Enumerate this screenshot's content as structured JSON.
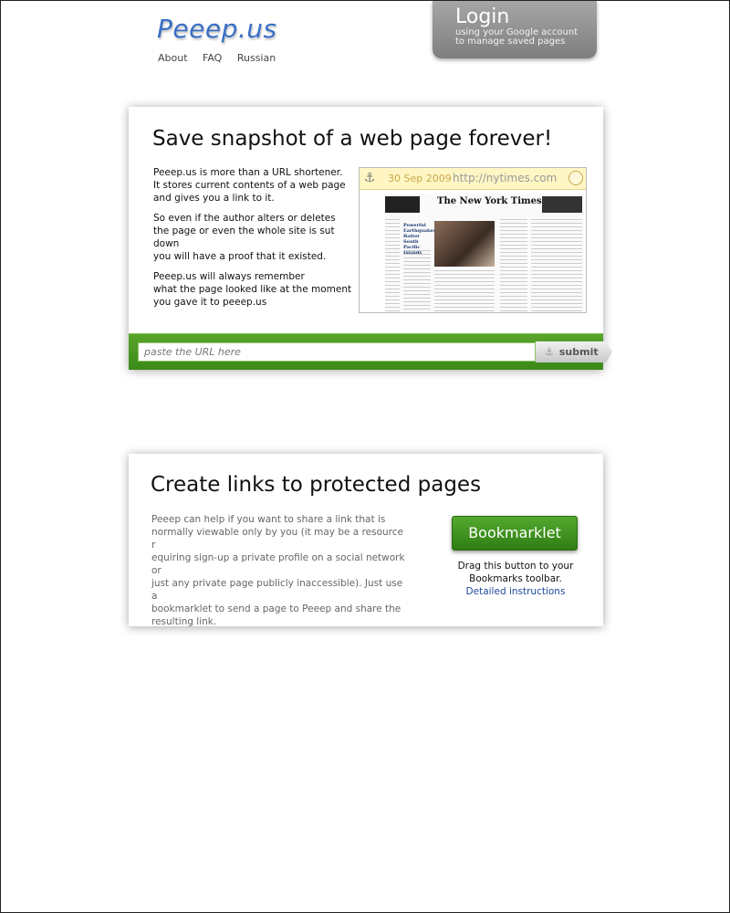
{
  "header": {
    "logo": "Peeep.us",
    "nav": [
      "About",
      "FAQ",
      "Russian"
    ]
  },
  "login": {
    "title": "Login",
    "subtitle_line1": "using your Google account",
    "subtitle_line2": "to manage saved pages"
  },
  "snapshot": {
    "title": "Save snapshot of a web page forever!",
    "paragraphs": [
      [
        "Peeep.us is more than a URL shortener.",
        "It stores current contents of a web page",
        "and gives you a link to it."
      ],
      [
        "So even if the author alters or deletes",
        "the page or even the whole site is sut down",
        "you will have a proof that it existed."
      ],
      [
        "Peeep.us will always remember",
        "what the page looked like at the moment",
        "you gave it to peeep.us"
      ]
    ],
    "preview": {
      "date": "30 Sep 2009",
      "url": "http://nytimes.com",
      "masthead": "The New York Times",
      "headline": "Powerful Earthquakes Batter South Pacific Islands"
    },
    "url_placeholder": "paste the URL here",
    "submit_label": "submit"
  },
  "protected": {
    "title": "Create links to protected pages",
    "lines": [
      "Peeep can help if you want to share a link that is",
      "normally viewable only by you (it may be a resource r",
      "equiring sign-up a private profile on a social network or",
      "just any private page publicly inaccessible). Just use a",
      "bookmarklet to send a page to Peeep and share the",
      "resulting link."
    ],
    "bookmarklet_label": "Bookmarklet",
    "help_line1": "Drag this button to your",
    "help_line2": "Bookmarks toolbar.",
    "instructions_link": "Detailed instructions"
  },
  "colors": {
    "logo": "#3a6fc4",
    "green_bar": "#3a8a18",
    "link": "#204a9a"
  }
}
